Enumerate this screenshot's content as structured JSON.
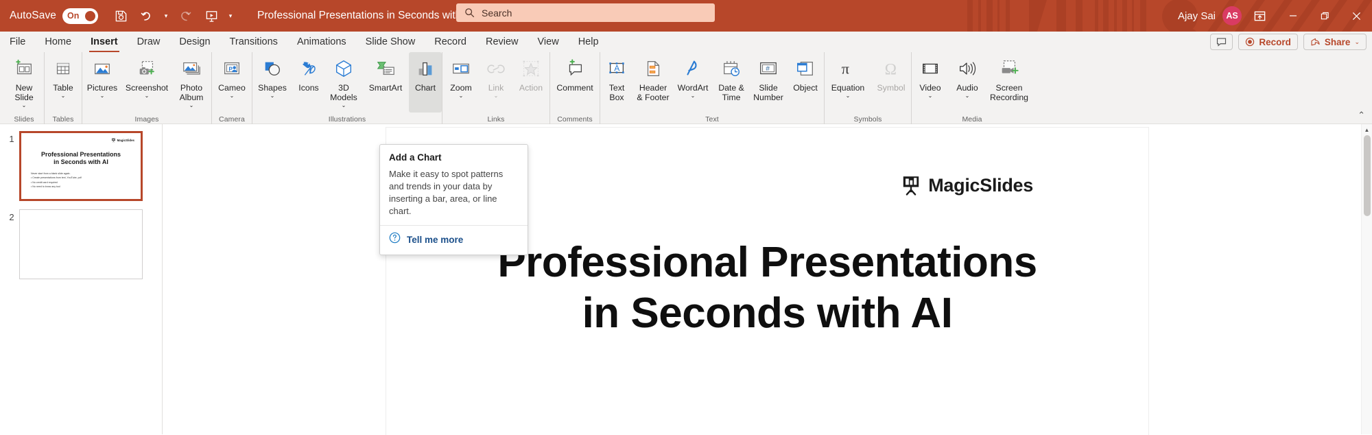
{
  "titlebar": {
    "autosave_label": "AutoSave",
    "autosave_state": "On",
    "document_title": "Professional Presentations in Seconds with AI • Saved",
    "save_icon": "save-icon",
    "undo_icon": "undo-icon",
    "redo_icon": "redo-icon",
    "present_icon": "start-presentation-icon",
    "qat_more_icon": "customize-quick-access-toolbar-icon",
    "account_name": "Ajay Sai",
    "account_initials": "AS",
    "minimize": "—",
    "restore": "❐",
    "close": "✕",
    "accent_color": "#b7472a",
    "search_accent": "#f9cbb7"
  },
  "search": {
    "placeholder": "Search",
    "icon": "search-icon"
  },
  "tabs": [
    {
      "label": "File",
      "active": false
    },
    {
      "label": "Home",
      "active": false
    },
    {
      "label": "Insert",
      "active": true
    },
    {
      "label": "Draw",
      "active": false
    },
    {
      "label": "Design",
      "active": false
    },
    {
      "label": "Transitions",
      "active": false
    },
    {
      "label": "Animations",
      "active": false
    },
    {
      "label": "Slide Show",
      "active": false
    },
    {
      "label": "Record",
      "active": false
    },
    {
      "label": "Review",
      "active": false
    },
    {
      "label": "View",
      "active": false
    },
    {
      "label": "Help",
      "active": false
    }
  ],
  "tabstrip_buttons": {
    "comments_icon": "comment-icon",
    "record_label": "Record",
    "record_icon": "record-circle-icon",
    "share_label": "Share",
    "share_icon": "share-icon",
    "share_chevron": "⌄"
  },
  "ribbon": {
    "collapse_icon": "collapse-ribbon-caret",
    "groups": [
      {
        "name": "Slides",
        "items": [
          {
            "label": "New",
            "label2": "Slide",
            "dropdown": true,
            "icon": "new-slide-icon",
            "state": "normal",
            "width": "w58"
          }
        ]
      },
      {
        "name": "Tables",
        "items": [
          {
            "label": "Table",
            "label2": "",
            "dropdown": true,
            "icon": "table-icon",
            "state": "normal",
            "width": "w54"
          }
        ]
      },
      {
        "name": "Images",
        "items": [
          {
            "label": "Pictures",
            "label2": "",
            "dropdown": true,
            "icon": "pictures-icon",
            "state": "normal",
            "width": "w58"
          },
          {
            "label": "Screenshot",
            "label2": "",
            "dropdown": true,
            "icon": "screenshot-icon",
            "state": "normal",
            "width": "w72"
          },
          {
            "label": "Photo",
            "label2": "Album",
            "dropdown": true,
            "icon": "photo-album-icon",
            "state": "normal",
            "width": "w58"
          }
        ]
      },
      {
        "name": "Camera",
        "items": [
          {
            "label": "Cameo",
            "label2": "",
            "dropdown": true,
            "icon": "cameo-icon",
            "state": "normal",
            "width": "w58"
          }
        ]
      },
      {
        "name": "Illustrations",
        "items": [
          {
            "label": "Shapes",
            "label2": "",
            "dropdown": true,
            "icon": "shapes-icon",
            "state": "normal",
            "width": "w58"
          },
          {
            "label": "Icons",
            "label2": "",
            "dropdown": false,
            "icon": "icons-icon",
            "state": "normal",
            "width": "w48"
          },
          {
            "label": "3D",
            "label2": "Models",
            "dropdown": true,
            "icon": "3d-models-icon",
            "state": "normal",
            "width": "w54"
          },
          {
            "label": "SmartArt",
            "label2": "",
            "dropdown": false,
            "icon": "smartart-icon",
            "state": "normal",
            "width": "w68"
          },
          {
            "label": "Chart",
            "label2": "",
            "dropdown": false,
            "icon": "chart-icon",
            "state": "selected",
            "width": "w48"
          }
        ]
      },
      {
        "name": "Links",
        "items": [
          {
            "label": "Zoom",
            "label2": "",
            "dropdown": true,
            "icon": "zoom-icon",
            "state": "normal",
            "width": "w54"
          },
          {
            "label": "Link",
            "label2": "",
            "dropdown": true,
            "icon": "link-icon",
            "state": "disabled",
            "width": "w48"
          },
          {
            "label": "Action",
            "label2": "",
            "dropdown": false,
            "icon": "action-icon",
            "state": "disabled",
            "width": "w54"
          }
        ]
      },
      {
        "name": "Comments",
        "items": [
          {
            "label": "Comment",
            "label2": "",
            "dropdown": false,
            "icon": "comment-add-icon",
            "state": "normal",
            "width": "w72"
          }
        ]
      },
      {
        "name": "Text",
        "items": [
          {
            "label": "Text",
            "label2": "Box",
            "dropdown": false,
            "icon": "text-box-icon",
            "state": "normal",
            "width": "w48"
          },
          {
            "label": "Header",
            "label2": "& Footer",
            "dropdown": false,
            "icon": "header-footer-icon",
            "state": "normal",
            "width": "w58"
          },
          {
            "label": "WordArt",
            "label2": "",
            "dropdown": true,
            "icon": "wordart-icon",
            "state": "normal",
            "width": "w58"
          },
          {
            "label": "Date &",
            "label2": "Time",
            "dropdown": false,
            "icon": "date-time-icon",
            "state": "normal",
            "width": "w54"
          },
          {
            "label": "Slide",
            "label2": "Number",
            "dropdown": false,
            "icon": "slide-number-icon",
            "state": "normal",
            "width": "w54"
          },
          {
            "label": "Object",
            "label2": "",
            "dropdown": false,
            "icon": "object-icon",
            "state": "normal",
            "width": "w54"
          }
        ]
      },
      {
        "name": "Symbols",
        "items": [
          {
            "label": "Equation",
            "label2": "",
            "dropdown": true,
            "icon": "equation-icon",
            "state": "normal",
            "width": "w68"
          },
          {
            "label": "Symbol",
            "label2": "",
            "dropdown": false,
            "icon": "symbol-icon",
            "state": "disabled",
            "width": "w58"
          }
        ]
      },
      {
        "name": "Media",
        "items": [
          {
            "label": "Video",
            "label2": "",
            "dropdown": true,
            "icon": "video-icon",
            "state": "normal",
            "width": "w54"
          },
          {
            "label": "Audio",
            "label2": "",
            "dropdown": true,
            "icon": "audio-icon",
            "state": "normal",
            "width": "w54"
          },
          {
            "label": "Screen",
            "label2": "Recording",
            "dropdown": false,
            "icon": "screen-recording-icon",
            "state": "normal",
            "width": "w68"
          }
        ]
      }
    ]
  },
  "tooltip": {
    "title": "Add a Chart",
    "body": "Make it easy to spot patterns and trends in your data by inserting a bar, area, or line chart.",
    "link_label": "Tell me more",
    "link_icon": "help-circle-icon"
  },
  "slide_panel": {
    "slides": [
      {
        "number": "1",
        "active": true,
        "logo_text": "MagicSlides",
        "title_line1": "Professional Presentations",
        "title_line2": "in Seconds with AI",
        "bullets": [
          "Never start from a blank slide again.",
          "• Create presentations from text, YouTube, pdf",
          "• No credit card required",
          "• No need to know any tool"
        ]
      },
      {
        "number": "2",
        "active": false,
        "logo_text": "",
        "title_line1": "",
        "title_line2": "",
        "bullets": []
      }
    ]
  },
  "slide": {
    "logo_text": "MagicSlides",
    "logo_icon": "magicslides-easel-icon",
    "title_line1": "Professional Presentations",
    "title_line2": "in Seconds with AI"
  },
  "scrollbar": {
    "up_arrow": "▲",
    "down_arrow": "▼"
  }
}
